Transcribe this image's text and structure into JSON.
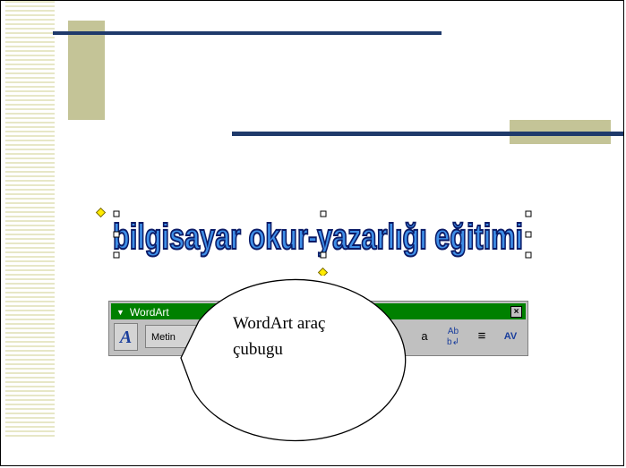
{
  "slide": {
    "colors": {
      "accent_bar": "#1f3a6b",
      "block": "#c4c497",
      "stripe": "#e7e7c6"
    }
  },
  "wordart": {
    "text": "bilgisayar okur-yazarlığı eğitimi",
    "fill_color": "#3f8fe8",
    "outline_color": "#0a1a66"
  },
  "toolbar": {
    "title": "WordArt",
    "title_bar_color": "#008000",
    "close_label": "×",
    "insert_icon": "wordart-insert-icon",
    "insert_glyph": "A",
    "edit_text_label": "Metin Düzenle",
    "icons": [
      {
        "name": "letter-height-icon",
        "glyph": "a"
      },
      {
        "name": "vertical-text-icon",
        "glyph": "Ab b↲"
      },
      {
        "name": "alignment-icon",
        "glyph": "≡"
      },
      {
        "name": "character-spacing-icon",
        "glyph": "AV"
      }
    ]
  },
  "callout": {
    "line1": "WordArt araç",
    "line2": "çubugu"
  }
}
